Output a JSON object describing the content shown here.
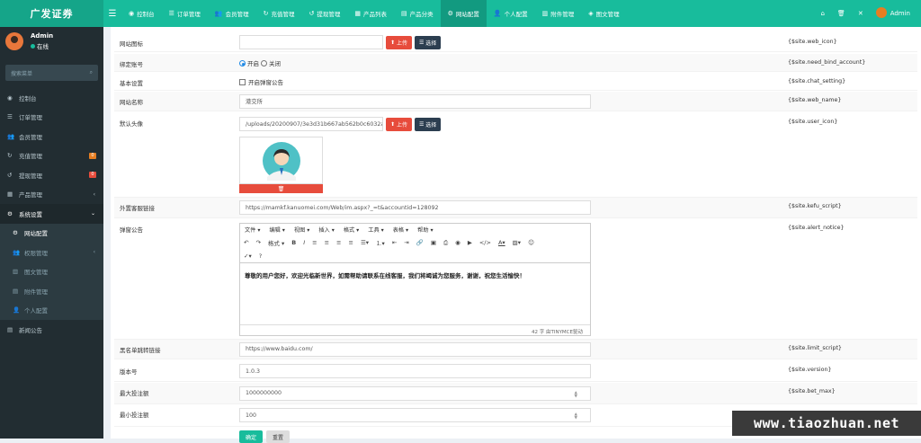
{
  "app": {
    "logo": "广发证券"
  },
  "topnav": [
    {
      "icon": "◉",
      "label": "控制台"
    },
    {
      "icon": "☰",
      "label": "订单管理"
    },
    {
      "icon": "👥",
      "label": "会员管理"
    },
    {
      "icon": "↻",
      "label": "充值管理"
    },
    {
      "icon": "↺",
      "label": "提现管理"
    },
    {
      "icon": "▦",
      "label": "产品列表"
    },
    {
      "icon": "▤",
      "label": "产品分类"
    },
    {
      "icon": "⚙",
      "label": "网站配置"
    },
    {
      "icon": "👤",
      "label": "个人配置"
    },
    {
      "icon": "▥",
      "label": "附件管理"
    },
    {
      "icon": "◈",
      "label": "图文管理"
    }
  ],
  "topright": {
    "user": "Admin"
  },
  "sidebar": {
    "user_name": "Admin",
    "user_status": "在线",
    "search_placeholder": "搜索菜单",
    "items": [
      {
        "icon": "◉",
        "label": "控制台"
      },
      {
        "icon": "☰",
        "label": "订单管理"
      },
      {
        "icon": "👥",
        "label": "会员管理"
      },
      {
        "icon": "↻",
        "label": "充值管理",
        "badge": "0"
      },
      {
        "icon": "↺",
        "label": "提现管理",
        "badge": "0"
      },
      {
        "icon": "▦",
        "label": "产品管理"
      },
      {
        "icon": "⚙",
        "label": "系统设置"
      },
      {
        "icon": "⚙",
        "label": "网站配置"
      },
      {
        "icon": "👥",
        "label": "权限管理"
      },
      {
        "icon": "▥",
        "label": "图文管理"
      },
      {
        "icon": "▤",
        "label": "附件管理"
      },
      {
        "icon": "👤",
        "label": "个人配置"
      },
      {
        "icon": "▤",
        "label": "新闻公告"
      }
    ]
  },
  "form": {
    "web_icon": {
      "label": "网站图标",
      "value": "",
      "var": "{$site.web_icon}"
    },
    "upload_label": "上传",
    "select_label": "选择",
    "bind_account": {
      "label": "绑定账号",
      "opt_on": "开启",
      "opt_off": "关闭",
      "var": "{$site.need_bind_account}"
    },
    "chat_setting": {
      "label": "基本设置",
      "checkbox": "开启弹窗公告",
      "var": "{$site.chat_setting}"
    },
    "web_name": {
      "label": "网站名称",
      "value": "港交所",
      "var": "{$site.web_name}"
    },
    "user_icon": {
      "label": "默认头像",
      "value": "/uploads/20200907/3e3d31b667ab562b0c6032abe4f0",
      "var": "{$site.user_icon}"
    },
    "kefu_script": {
      "label": "外置客服链接",
      "value": "https://mamkf.kanuomei.com/Web/im.aspx?_=t&accountid=128092",
      "var": "{$site.kefu_script}"
    },
    "alert_notice": {
      "label": "弹窗公告",
      "menus": [
        "文件",
        "编辑",
        "视图",
        "插入",
        "格式",
        "工具",
        "表格",
        "帮助"
      ],
      "format_label": "格式",
      "content": "尊敬的用户您好，欢迎光临新世界，如需帮助请联系在线客服，我们将竭诚为您服务，谢谢，祝您生活愉快！",
      "status": "42 字 由TINYMCE驱动",
      "var": "{$site.alert_notice}"
    },
    "limit_script": {
      "label": "黑名单跳转链接",
      "value": "https://www.baidu.com/",
      "var": "{$site.limit_script}"
    },
    "version": {
      "label": "版本号",
      "value": "1.0.3",
      "var": "{$site.version}"
    },
    "bet_max": {
      "label": "最大投注额",
      "value": "1000000000",
      "var": "{$site.bet_max}"
    },
    "bet_min": {
      "label": "最小投注额",
      "value": "100",
      "var": ""
    },
    "submit_label": "确定",
    "reset_label": "重置"
  },
  "watermark": "www.tiaozhuan.net"
}
